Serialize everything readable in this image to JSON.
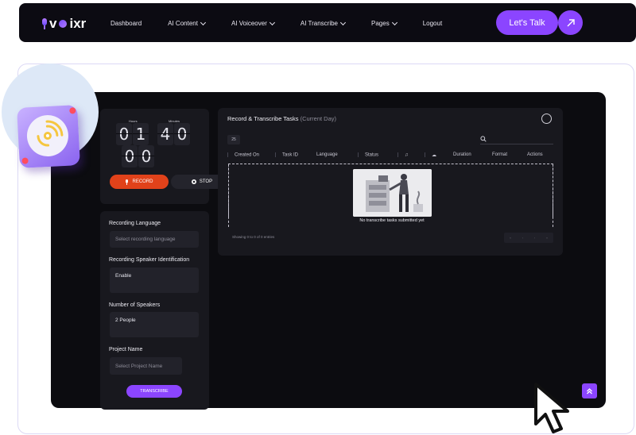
{
  "brand": {
    "logo_text_v": "v",
    "logo_text_rest": "ixr",
    "accent": "#8b45ff"
  },
  "nav": {
    "items": [
      {
        "label": "Dashboard",
        "dropdown": false
      },
      {
        "label": "AI Content",
        "dropdown": true
      },
      {
        "label": "AI Voiceover",
        "dropdown": true
      },
      {
        "label": "AI Transcribe",
        "dropdown": true
      },
      {
        "label": "Pages",
        "dropdown": true
      },
      {
        "label": "Logout",
        "dropdown": false
      }
    ],
    "cta_label": "Let's Talk",
    "cta_icon": "arrow-up-right-icon"
  },
  "timer": {
    "hours_label": "Hours",
    "minutes_label": "Minutes",
    "hours": [
      "0",
      "1"
    ],
    "minutes": [
      "4",
      "0"
    ],
    "seconds": [
      "0",
      "0"
    ],
    "record_label": "RECORD",
    "stop_label": "STOP"
  },
  "form": {
    "language_label": "Recording Language",
    "language_placeholder": "Select recording language",
    "speaker_id_label": "Recording Speaker Identification",
    "speaker_id_value": "Enable",
    "speakers_label": "Number of Speakers",
    "speakers_value": "2 People",
    "project_label": "Project Name",
    "project_placeholder": "Select Project Name",
    "submit_label": "TRANSCRIBE"
  },
  "tasks": {
    "title": "Record & Transcribe Tasks",
    "subtitle": "(Current Day)",
    "page_size": "25",
    "columns": [
      "Created On",
      "Task ID",
      "Language",
      "Status",
      "♫",
      "☁",
      "Duration",
      "Format",
      "Actions"
    ],
    "empty_text": "No transcribe tasks submitted yet",
    "showing_text": "Showing 0 to 0 of 0 entries"
  }
}
